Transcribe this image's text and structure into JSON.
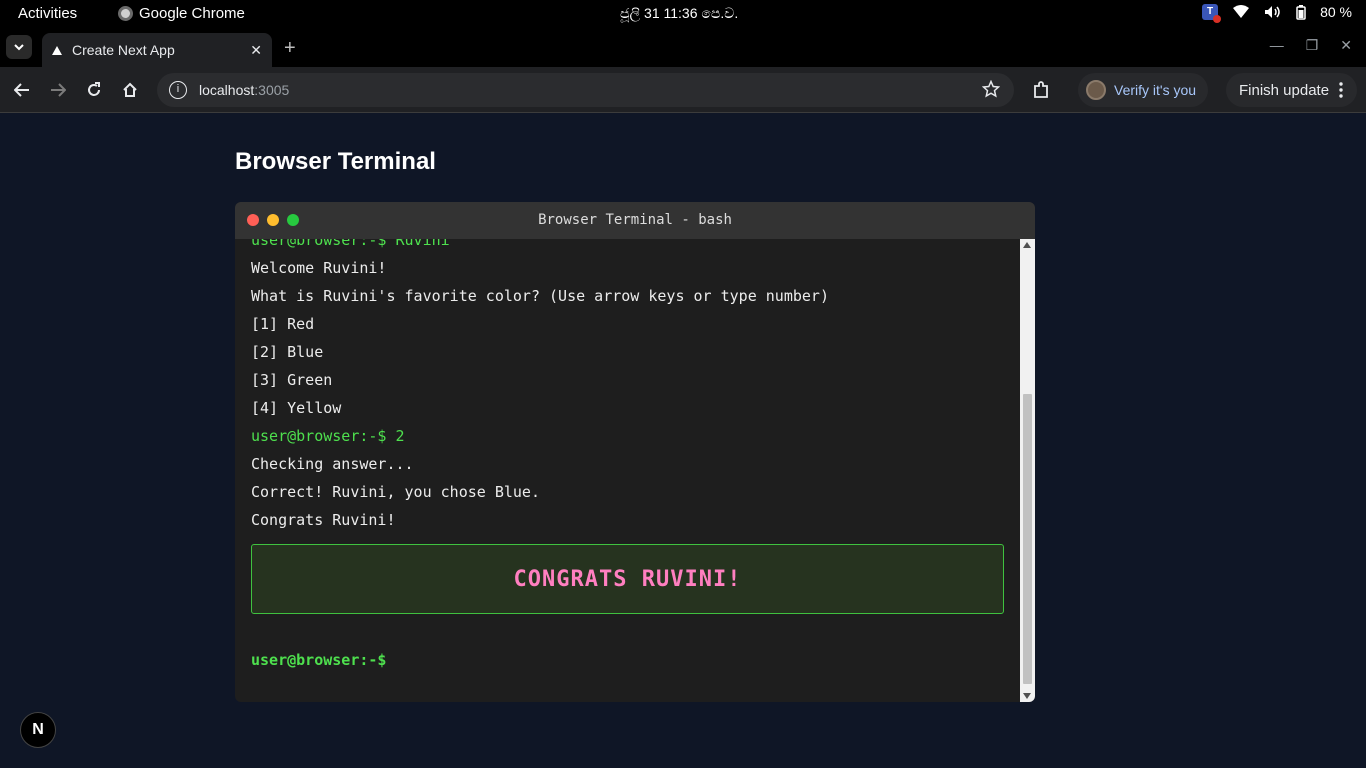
{
  "system_bar": {
    "activities": "Activities",
    "app_name": "Google Chrome",
    "clock": "ජූලි 31  11:36 පෙ.ව.",
    "battery": "80 %"
  },
  "browser": {
    "tab_title": "Create Next App",
    "url_host": "localhost",
    "url_port": ":3005",
    "verify_label": "Verify it's you",
    "finish_update_label": "Finish update"
  },
  "page": {
    "heading": "Browser Terminal",
    "terminal": {
      "title": "Browser Terminal - bash",
      "lines": [
        {
          "text": "user@browser:-$ Ruvini",
          "kind": "prompt"
        },
        {
          "text": "Welcome Ruvini!",
          "kind": "output"
        },
        {
          "text": "What is Ruvini's favorite color? (Use arrow keys or type number)",
          "kind": "output"
        },
        {
          "text": "[1] Red",
          "kind": "output"
        },
        {
          "text": "[2] Blue",
          "kind": "output"
        },
        {
          "text": "[3] Green",
          "kind": "output"
        },
        {
          "text": "[4] Yellow",
          "kind": "output"
        },
        {
          "text": "user@browser:-$ 2",
          "kind": "prompt"
        },
        {
          "text": "Checking answer...",
          "kind": "output"
        },
        {
          "text": "Correct! Ruvini, you chose Blue.",
          "kind": "output"
        },
        {
          "text": "Congrats Ruvini!",
          "kind": "output"
        }
      ],
      "banner": "CONGRATS RUVINI!",
      "prompt": "user@browser:-$",
      "window_buttons": {
        "close": "#ff5f56",
        "minimize": "#ffbd2e",
        "maximize": "#27c93f"
      }
    },
    "next_badge": "N"
  }
}
